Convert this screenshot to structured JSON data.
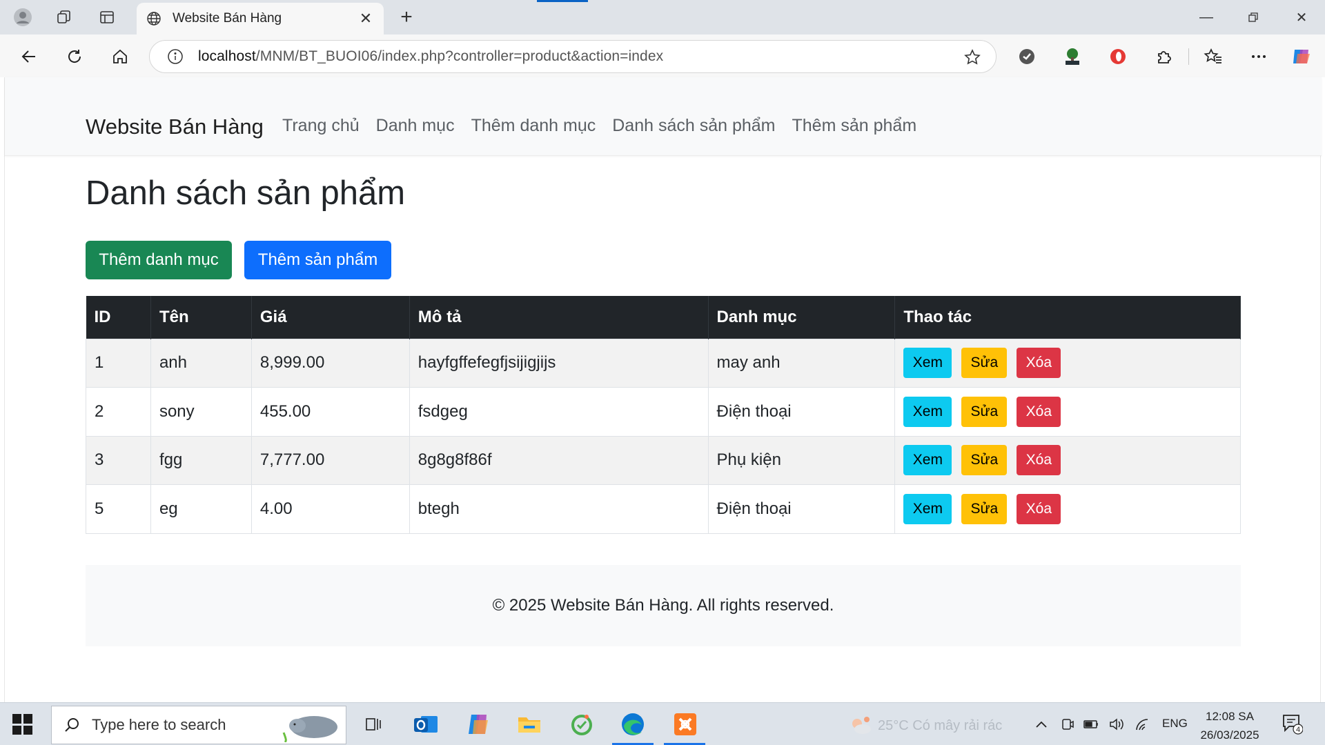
{
  "browser": {
    "tab_title": "Website Bán Hàng",
    "url_host": "localhost",
    "url_path": "/MNM/BT_BUOI06/index.php?controller=product&action=index",
    "icons": [
      "profile-icon",
      "workspaces-icon",
      "tab-actions-icon",
      "globe-icon",
      "close-icon",
      "plus-icon",
      "minimize-icon",
      "restore-icon",
      "close-window-icon",
      "back-icon",
      "refresh-icon",
      "home-icon",
      "info-icon",
      "favorite-star-icon",
      "extension-icons",
      "favorites-icon",
      "more-icon",
      "copilot-icon"
    ]
  },
  "navbar": {
    "brand": "Website Bán Hàng",
    "links": [
      "Trang chủ",
      "Danh mục",
      "Thêm danh mục",
      "Danh sách sản phẩm",
      "Thêm sản phẩm"
    ]
  },
  "main": {
    "title": "Danh sách sản phẩm",
    "buttons": {
      "add_category": "Thêm danh mục",
      "add_product": "Thêm sản phẩm"
    },
    "table": {
      "headers": [
        "ID",
        "Tên",
        "Giá",
        "Mô tả",
        "Danh mục",
        "Thao tác"
      ],
      "actions": {
        "view": "Xem",
        "edit": "Sửa",
        "delete": "Xóa"
      },
      "rows": [
        {
          "id": "1",
          "name": "anh",
          "price": "8,999.00",
          "desc": "hayfgffefegfjsijigjijs",
          "category": "may anh"
        },
        {
          "id": "2",
          "name": "sony",
          "price": "455.00",
          "desc": "fsdgeg",
          "category": "Điện thoại"
        },
        {
          "id": "3",
          "name": "fgg",
          "price": "7,777.00",
          "desc": "8g8g8f86f",
          "category": "Phụ kiện"
        },
        {
          "id": "5",
          "name": "eg",
          "price": "4.00",
          "desc": "btegh",
          "category": "Điện thoại"
        }
      ]
    }
  },
  "footer": {
    "text": "© 2025 Website Bán Hàng. All rights reserved."
  },
  "taskbar": {
    "search_placeholder": "Type here to search",
    "weather": "25°C  Có mây rải rác",
    "language": "ENG",
    "time": "12:08 SA",
    "date": "26/03/2025",
    "notification_count": "4",
    "accent": "#1a73e8"
  },
  "colors": {
    "success": "#198754",
    "primary": "#0d6efd",
    "info": "#0dcaf0",
    "warning": "#ffc107",
    "danger": "#dc3545",
    "dark": "#212529"
  }
}
